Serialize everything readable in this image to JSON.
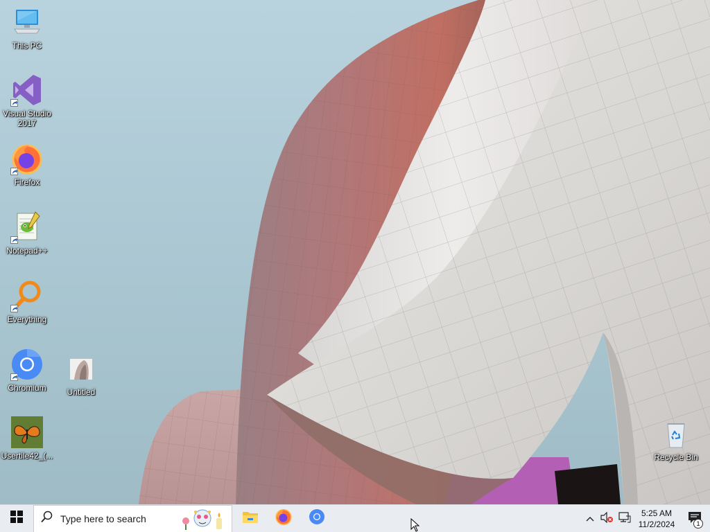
{
  "desktop": {
    "icons": [
      {
        "label": "This PC",
        "icon": "computer-icon"
      },
      {
        "label": "Visual Studio 2017",
        "icon": "visual-studio-icon"
      },
      {
        "label": "Firefox",
        "icon": "firefox-icon"
      },
      {
        "label": "Notepad++",
        "icon": "notepad-plus-plus-icon"
      },
      {
        "label": "Everything",
        "icon": "search-magnifier-icon"
      },
      {
        "label": "Chromium",
        "icon": "chromium-icon"
      },
      {
        "label": "Untitled",
        "icon": "image-file-icon"
      },
      {
        "label": "Usertile42_(...",
        "icon": "butterfly-image-icon"
      },
      {
        "label": "Recycle Bin",
        "icon": "recycle-bin-icon"
      }
    ]
  },
  "taskbar": {
    "start_icon": "windows-logo-icon",
    "search": {
      "placeholder": "Type here to search"
    },
    "pinned": [
      {
        "name": "File Explorer",
        "icon": "folder-icon"
      },
      {
        "name": "Firefox",
        "icon": "firefox-icon"
      },
      {
        "name": "Chromium",
        "icon": "chromium-icon"
      }
    ],
    "tray": {
      "time": "5:25 AM",
      "date": "11/2/2024",
      "notification_count": "1"
    }
  },
  "colors": {
    "taskbar_bg": "#e9ecf1",
    "chromium_blue": "#4a8af4",
    "vs_purple": "#865fc5",
    "everything_orange": "#f08a1c"
  }
}
